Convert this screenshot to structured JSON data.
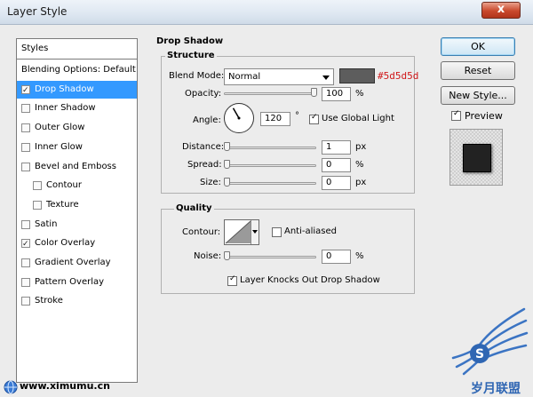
{
  "window": {
    "title": "Layer Style",
    "close_glyph": "x"
  },
  "styles_list": {
    "header": "Styles",
    "items": [
      {
        "label": "Blending Options: Default",
        "checkbox": false,
        "checked": false,
        "selected": false,
        "indent": 0
      },
      {
        "label": "Drop Shadow",
        "checkbox": true,
        "checked": true,
        "selected": true,
        "indent": 0
      },
      {
        "label": "Inner Shadow",
        "checkbox": true,
        "checked": false,
        "selected": false,
        "indent": 0
      },
      {
        "label": "Outer Glow",
        "checkbox": true,
        "checked": false,
        "selected": false,
        "indent": 0
      },
      {
        "label": "Inner Glow",
        "checkbox": true,
        "checked": false,
        "selected": false,
        "indent": 0
      },
      {
        "label": "Bevel and Emboss",
        "checkbox": true,
        "checked": false,
        "selected": false,
        "indent": 0
      },
      {
        "label": "Contour",
        "checkbox": true,
        "checked": false,
        "selected": false,
        "indent": 1
      },
      {
        "label": "Texture",
        "checkbox": true,
        "checked": false,
        "selected": false,
        "indent": 1
      },
      {
        "label": "Satin",
        "checkbox": true,
        "checked": false,
        "selected": false,
        "indent": 0
      },
      {
        "label": "Color Overlay",
        "checkbox": true,
        "checked": true,
        "selected": false,
        "indent": 0
      },
      {
        "label": "Gradient Overlay",
        "checkbox": true,
        "checked": false,
        "selected": false,
        "indent": 0
      },
      {
        "label": "Pattern Overlay",
        "checkbox": true,
        "checked": false,
        "selected": false,
        "indent": 0
      },
      {
        "label": "Stroke",
        "checkbox": true,
        "checked": false,
        "selected": false,
        "indent": 0
      }
    ]
  },
  "drop_shadow": {
    "section_title": "Drop Shadow",
    "structure": {
      "title": "Structure",
      "blend_mode_label": "Blend Mode:",
      "blend_mode_value": "Normal",
      "shadow_color": "#5d5d5d",
      "shadow_color_label": "#5d5d5d",
      "opacity_label": "Opacity:",
      "opacity_value": "100",
      "opacity_unit": "%",
      "opacity_level": 1.0,
      "angle_label": "Angle:",
      "angle_value": "120",
      "angle_unit": "°",
      "angle_degrees": 120,
      "global_light_label": "Use Global Light",
      "global_light_checked": true,
      "distance_label": "Distance:",
      "distance_value": "1",
      "distance_unit": "px",
      "distance_level": 0.0,
      "spread_label": "Spread:",
      "spread_value": "0",
      "spread_unit": "%",
      "spread_level": 0.0,
      "size_label": "Size:",
      "size_value": "0",
      "size_unit": "px",
      "size_level": 0.0
    },
    "quality": {
      "title": "Quality",
      "contour_label": "Contour:",
      "anti_aliased_label": "Anti-aliased",
      "anti_aliased_checked": false,
      "noise_label": "Noise:",
      "noise_value": "0",
      "noise_unit": "%",
      "noise_level": 0.0
    },
    "knockout_label": "Layer Knocks Out Drop Shadow",
    "knockout_checked": true
  },
  "buttons": {
    "ok": "OK",
    "reset": "Reset",
    "new_style": "New Style...",
    "preview_label": "Preview",
    "preview_checked": true
  },
  "watermark": {
    "footer_url": "www.ximumu.cn",
    "brand_text": "岁月联盟"
  },
  "icons": {
    "close": "close-icon",
    "dropdown": "chevron-down-icon",
    "angle_dial": "angle-dial-icon",
    "contour_preview": "contour-curve-icon",
    "wings": "wings-logo-icon",
    "globe": "globe-icon"
  }
}
